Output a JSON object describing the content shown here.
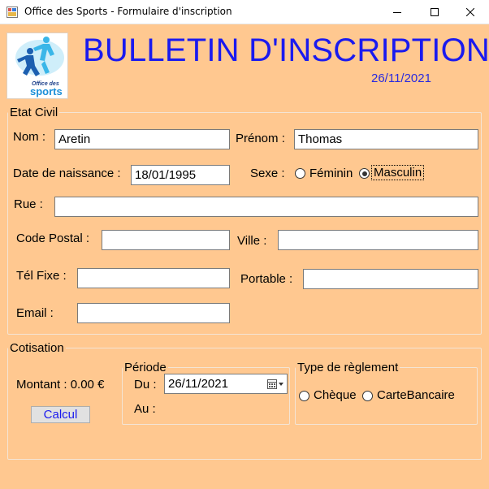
{
  "window": {
    "title": "Office des Sports - Formulaire d'inscription"
  },
  "header": {
    "logo_text_top": "Office des",
    "logo_text_main": "sports",
    "title": "BULLETIN D'INSCRIPTION",
    "date": "26/11/2021"
  },
  "etat_civil": {
    "legend": "Etat Civil",
    "nom_label": "Nom :",
    "nom_value": "Aretin",
    "prenom_label": "Prénom :",
    "prenom_value": "Thomas",
    "naissance_label": "Date de naissance :",
    "naissance_value": "18/01/1995",
    "sexe_label": "Sexe :",
    "feminin_label": "Féminin",
    "masculin_label": "Masculin",
    "rue_label": "Rue :",
    "rue_value": "",
    "cp_label": "Code Postal :",
    "cp_value": "",
    "ville_label": "Ville :",
    "ville_value": "",
    "tel_label": "Tél Fixe :",
    "tel_value": "",
    "portable_label": "Portable :",
    "portable_value": "",
    "email_label": "Email :",
    "email_value": ""
  },
  "cotisation": {
    "legend": "Cotisation",
    "montant_label": "Montant : 0.00 €",
    "calcul_label": "Calcul",
    "periode_legend": "Période",
    "du_label": "Du :",
    "du_value": "26/11/2021",
    "au_label": "Au :",
    "reglement_legend": "Type de règlement",
    "cheque_label": "Chèque",
    "carte_label": "CarteBancaire"
  }
}
